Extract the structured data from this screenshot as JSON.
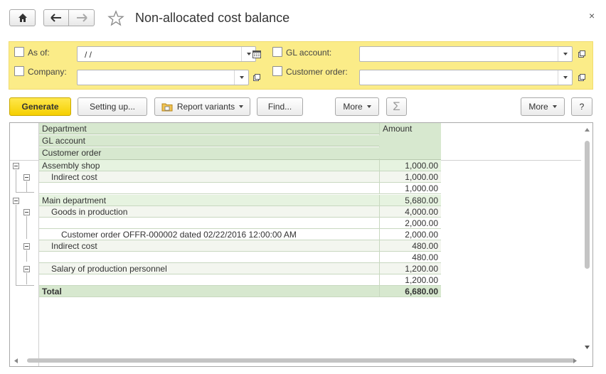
{
  "window": {
    "title": "Non-allocated cost balance",
    "close_label": "×"
  },
  "filters": {
    "as_of_label": "As of:",
    "as_of_value": " /  /",
    "company_label": "Company:",
    "company_value": "",
    "gl_account_label": "GL account:",
    "gl_account_value": "",
    "customer_order_label": "Customer order:",
    "customer_order_value": ""
  },
  "toolbar": {
    "generate": "Generate",
    "setting_up": "Setting up...",
    "report_variants": "Report variants",
    "find": "Find...",
    "more_left": "More",
    "sum_icon": "Σ",
    "more_right": "More",
    "help": "?"
  },
  "report": {
    "header": {
      "col1_line1": "Department",
      "col1_line2": "GL account",
      "col1_line3": "Customer order",
      "col2": "Amount"
    },
    "rows": [
      {
        "label": "Assembly shop",
        "amount": "1,000.00"
      },
      {
        "label": "Indirect cost",
        "amount": "1,000.00"
      },
      {
        "label": "",
        "amount": "1,000.00"
      },
      {
        "label": "Main department",
        "amount": "5,680.00"
      },
      {
        "label": "Goods in production",
        "amount": "4,000.00"
      },
      {
        "label": "",
        "amount": "2,000.00"
      },
      {
        "label": "Customer order OFFR-000002 dated 02/22/2016 12:00:00 AM",
        "amount": "2,000.00"
      },
      {
        "label": "Indirect cost",
        "amount": "480.00"
      },
      {
        "label": "",
        "amount": "480.00"
      },
      {
        "label": "Salary of production personnel",
        "amount": "1,200.00"
      },
      {
        "label": "",
        "amount": "1,200.00"
      }
    ],
    "total": {
      "label": "Total",
      "amount": "6,680.00"
    }
  },
  "colors": {
    "accent_yellow": "#f5cf00",
    "filter_bg": "#fbec88",
    "header_green": "#d7e8cf"
  }
}
